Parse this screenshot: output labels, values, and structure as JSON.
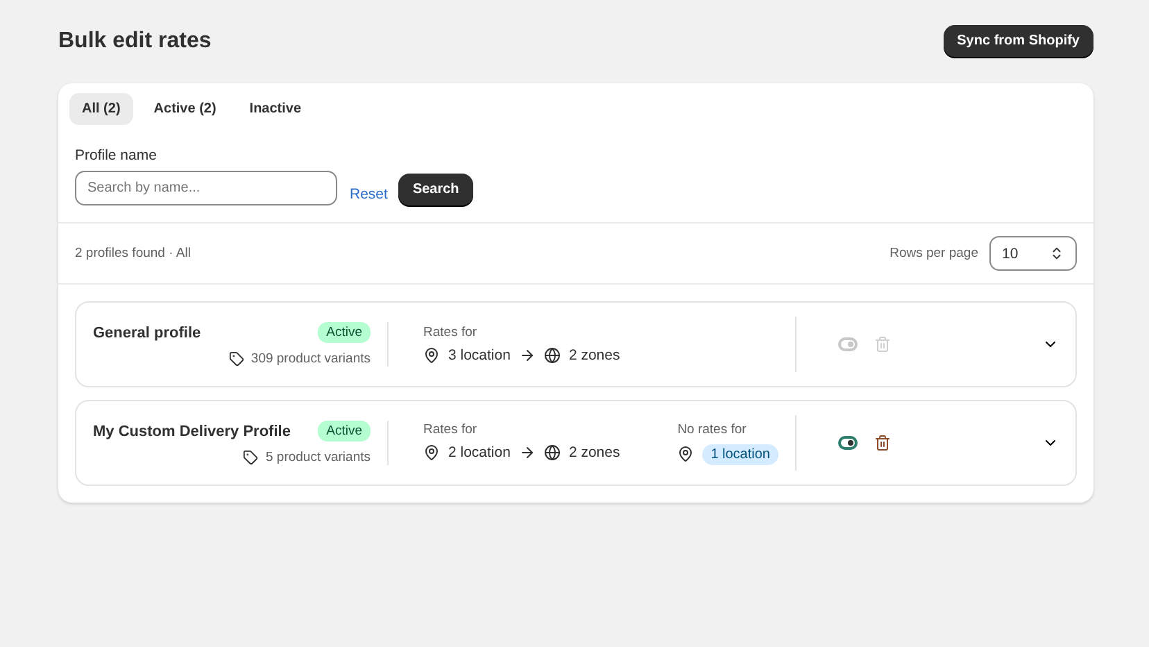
{
  "page": {
    "title": "Bulk edit rates",
    "action": "Sync from Shopify"
  },
  "tabs": [
    {
      "label": "All (2)",
      "selected": true
    },
    {
      "label": "Active (2)",
      "selected": false
    },
    {
      "label": "Inactive",
      "selected": false
    }
  ],
  "filter": {
    "label": "Profile name",
    "placeholder": "Search by name...",
    "reset": "Reset",
    "search": "Search"
  },
  "summary": "2 profiles found · All",
  "rows_per_page": {
    "label": "Rows per page",
    "value": "10"
  },
  "profiles": [
    {
      "name": "General profile",
      "status": "Active",
      "variants": "309 product variants",
      "rates_label": "Rates for",
      "locations": "3 location",
      "zones": "2 zones",
      "actions_disabled": true
    },
    {
      "name": "My Custom Delivery Profile",
      "status": "Active",
      "variants": "5 product variants",
      "rates_label": "Rates for",
      "locations": "2 location",
      "zones": "2 zones",
      "no_rates_label": "No rates for",
      "no_rates_locations": "1 location",
      "actions_disabled": false
    }
  ]
}
